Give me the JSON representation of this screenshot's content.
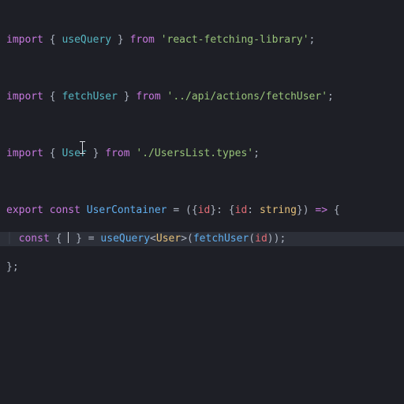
{
  "lines": {
    "l1": {
      "kw": "import",
      "brace_o": " { ",
      "name": "useQuery",
      "brace_c": " } ",
      "from": "from",
      "sp": " ",
      "q": "'",
      "str": "react-fetching-library",
      "semi": ";"
    },
    "l3": {
      "kw": "import",
      "brace_o": " { ",
      "name": "fetchUser",
      "brace_c": " } ",
      "from": "from",
      "sp": " ",
      "q": "'",
      "str": "../api/actions/fetchUser",
      "semi": ";"
    },
    "l5": {
      "kw": "import",
      "brace_o": " { ",
      "name": "User",
      "brace_c": " } ",
      "from": "from",
      "sp": " ",
      "q": "'",
      "str": "./UsersList.types",
      "semi": ";"
    },
    "l7": {
      "export": "export",
      "sp": " ",
      "const": "const",
      "name": "UserContainer",
      "eq": " = ",
      "po": "(",
      "bo": "{",
      "id": "id",
      "bc": "}",
      "colon": ": ",
      "bo2": "{",
      "id2": "id",
      "colon2": ": ",
      "type": "string",
      "bc2": "}",
      "pc": ")",
      "arrow": " => ",
      "open": "{"
    },
    "l8": {
      "indent": "│ ",
      "const": "const",
      "sp": " ",
      "bo": "{ ",
      "bc": " }",
      "eq": " = ",
      "fn": "useQuery",
      "lt": "<",
      "type": "User",
      "gt": ">",
      "po": "(",
      "call": "fetchUser",
      "po2": "(",
      "arg": "id",
      "pc2": ")",
      "pc": ")",
      "semi": ";"
    },
    "l9": {
      "close": "};"
    }
  }
}
